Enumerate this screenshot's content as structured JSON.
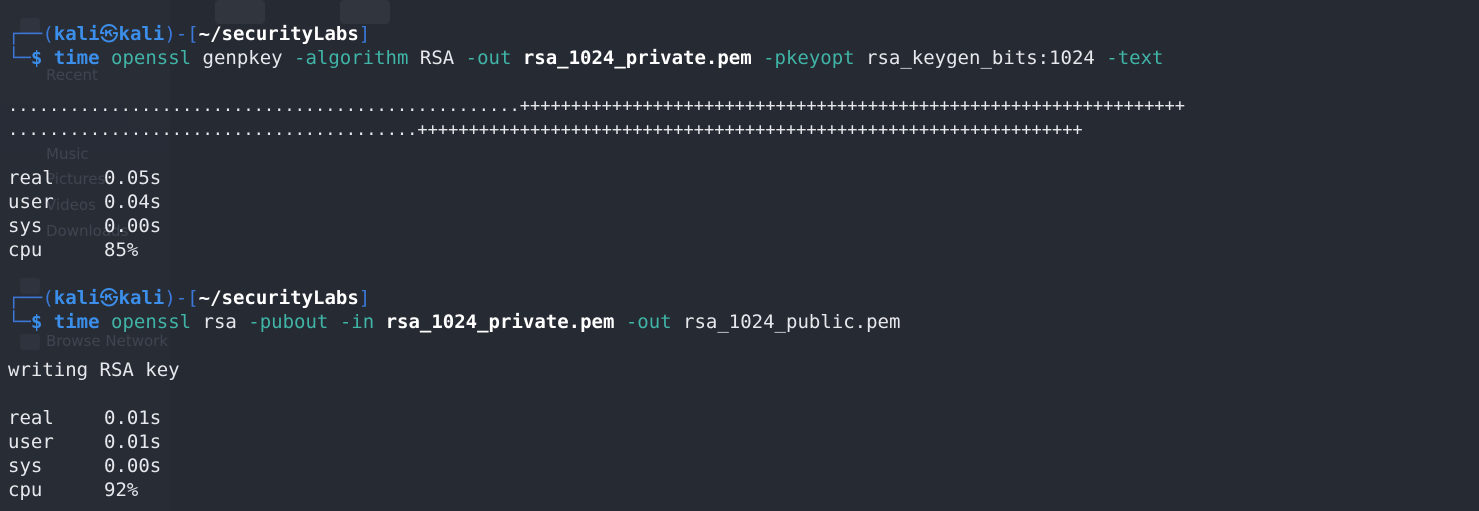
{
  "prompt": {
    "user": "kali",
    "host": "kali",
    "at_symbol": "㉿",
    "cwd": "~/securityLabs",
    "frame_top": "┌──(",
    "frame_mid": ")-[",
    "frame_end": "]",
    "frame_bottom": "└─",
    "dollar": "$"
  },
  "blocks": [
    {
      "command": {
        "time": "time",
        "program": "openssl",
        "parts": [
          {
            "text": " genpkey ",
            "kind": "arg"
          },
          {
            "text": "-algorithm",
            "kind": "opt"
          },
          {
            "text": " RSA ",
            "kind": "arg"
          },
          {
            "text": "-out",
            "kind": "opt"
          },
          {
            "text": " ",
            "kind": "arg"
          },
          {
            "text": "rsa_1024_private.pem",
            "kind": "file"
          },
          {
            "text": " ",
            "kind": "arg"
          },
          {
            "text": "-pkeyopt",
            "kind": "opt"
          },
          {
            "text": " rsa_keygen_bits:1024 ",
            "kind": "arg"
          },
          {
            "text": "-text",
            "kind": "opt"
          }
        ]
      },
      "output": [
        "..................................................+++++++++++++++++++++++++++++++++++++++++++++++++++++++++++++++++",
        "........................................+++++++++++++++++++++++++++++++++++++++++++++++++++++++++++++++++"
      ],
      "timing": {
        "real": "0.05s",
        "user": "0.04s",
        "sys": "0.00s",
        "cpu": "85%"
      }
    },
    {
      "command": {
        "time": "time",
        "program": "openssl",
        "parts": [
          {
            "text": " rsa ",
            "kind": "arg"
          },
          {
            "text": "-pubout",
            "kind": "opt"
          },
          {
            "text": " ",
            "kind": "arg"
          },
          {
            "text": "-in",
            "kind": "opt"
          },
          {
            "text": " ",
            "kind": "arg"
          },
          {
            "text": "rsa_1024_private.pem",
            "kind": "file"
          },
          {
            "text": " ",
            "kind": "arg"
          },
          {
            "text": "-out",
            "kind": "opt"
          },
          {
            "text": " rsa_1024_public.pem",
            "kind": "arg"
          }
        ]
      },
      "output": [
        "writing RSA key"
      ],
      "timing": {
        "real": "0.01s",
        "user": "0.01s",
        "sys": "0.00s",
        "cpu": "92%"
      }
    }
  ],
  "timing_labels": {
    "real": "real",
    "user": "user",
    "sys": "sys",
    "cpu": "cpu"
  },
  "ghost_sidebar": {
    "items": [
      "Recent",
      "Music",
      "Pictures",
      "Videos",
      "Downloads",
      "Browse Network"
    ]
  },
  "colors": {
    "background": "#262a33",
    "prompt_blue": "#3b8eea",
    "frame_blue": "#3b78d8",
    "option_teal": "#40b4a6",
    "text": "#e6e8ec"
  }
}
